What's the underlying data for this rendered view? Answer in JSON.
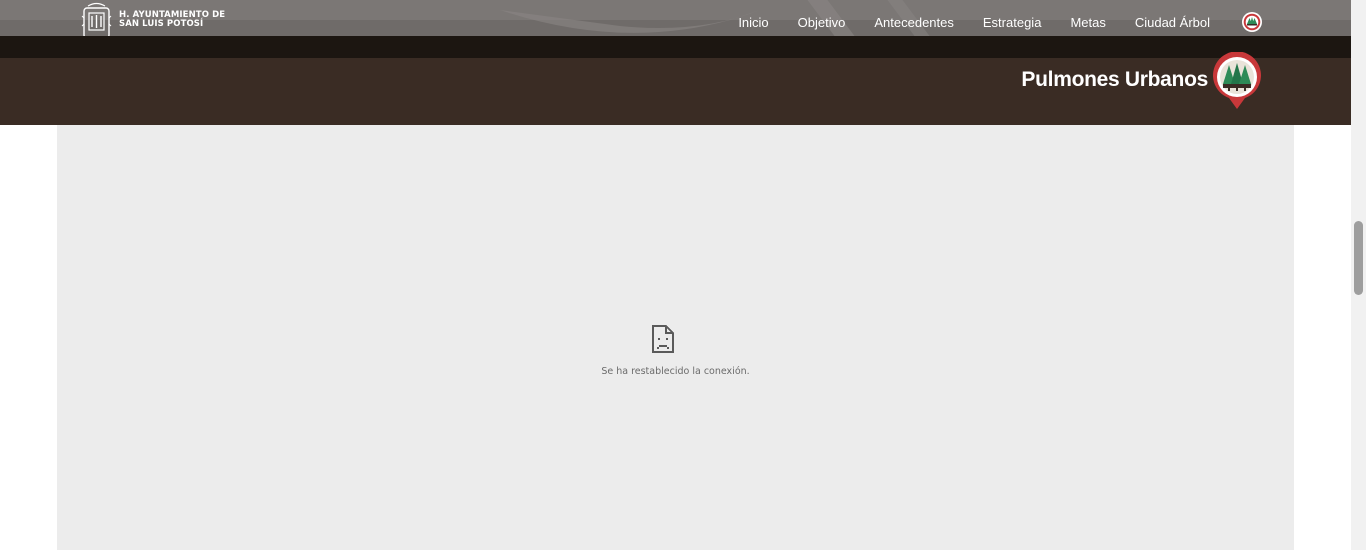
{
  "header": {
    "logo_lines": [
      "H. AYUNTAMIENTO DE",
      "SAN LUIS POTOSÍ"
    ],
    "nav_items": [
      {
        "label": "Inicio"
      },
      {
        "label": "Objetivo"
      },
      {
        "label": "Antecedentes"
      },
      {
        "label": "Estrategia"
      },
      {
        "label": "Metas"
      },
      {
        "label": "Ciudad Árbol"
      }
    ],
    "badge_icon": "tree-badge-icon"
  },
  "titlebar": {
    "title": "Pulmones Urbanos",
    "marker_icon": "tree-map-pin-icon"
  },
  "embedded_frame": {
    "error_icon": "sad-document-icon",
    "error_message": "Se ha restablecido la conexión."
  },
  "colors": {
    "nav_background": "#6f6b69",
    "dark_strip": "#1c1611",
    "titlebar_background": "#3a2c24",
    "frame_background": "#ececec",
    "marker_red": "#c8383a",
    "tree_green": "#2e8b57"
  }
}
